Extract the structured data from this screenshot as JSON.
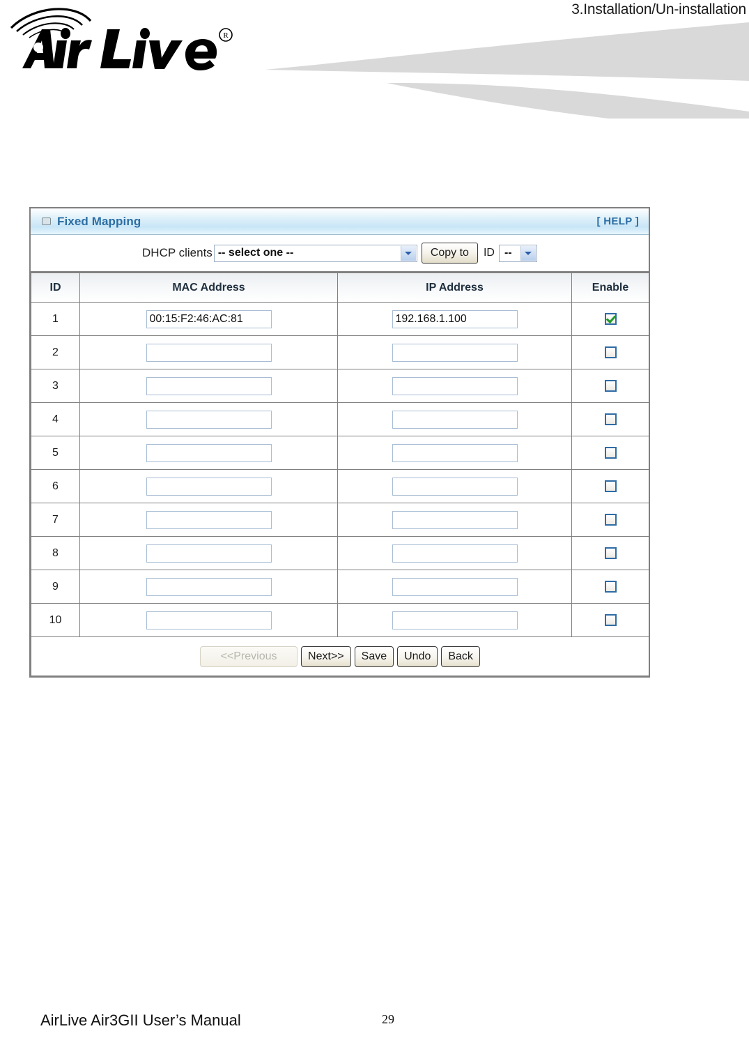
{
  "page": {
    "header_title": "3.Installation/Un-installation",
    "logo_text": "Air Live",
    "logo_mark": "®",
    "footer_manual": "AirLive Air3GII User’s Manual",
    "footer_page_number": "29"
  },
  "panel": {
    "title": "Fixed Mapping",
    "title_icon": "window-box-icon",
    "help_label": "[ HELP ]",
    "accent_color": "#2c6ea3",
    "titlebar_color": "#c8e6f7",
    "border_color": "#808080"
  },
  "dhcp_bar": {
    "label": "DHCP clients",
    "select_value": "-- select one --",
    "select_placeholder": "-- select one --",
    "copy_button": "Copy to",
    "id_label": "ID",
    "id_select_value": "--"
  },
  "table": {
    "columns": [
      "ID",
      "MAC Address",
      "IP Address",
      "Enable"
    ],
    "rows": [
      {
        "id": "1",
        "mac": "00:15:F2:46:AC:81",
        "ip": "192.168.1.100",
        "enabled": true
      },
      {
        "id": "2",
        "mac": "",
        "ip": "",
        "enabled": false
      },
      {
        "id": "3",
        "mac": "",
        "ip": "",
        "enabled": false
      },
      {
        "id": "4",
        "mac": "",
        "ip": "",
        "enabled": false
      },
      {
        "id": "5",
        "mac": "",
        "ip": "",
        "enabled": false
      },
      {
        "id": "6",
        "mac": "",
        "ip": "",
        "enabled": false
      },
      {
        "id": "7",
        "mac": "",
        "ip": "",
        "enabled": false
      },
      {
        "id": "8",
        "mac": "",
        "ip": "",
        "enabled": false
      },
      {
        "id": "9",
        "mac": "",
        "ip": "",
        "enabled": false
      },
      {
        "id": "10",
        "mac": "",
        "ip": "",
        "enabled": false
      }
    ]
  },
  "buttons": {
    "previous": "<<Previous",
    "previous_disabled": true,
    "next": "Next>>",
    "save": "Save",
    "undo": "Undo",
    "back": "Back"
  }
}
